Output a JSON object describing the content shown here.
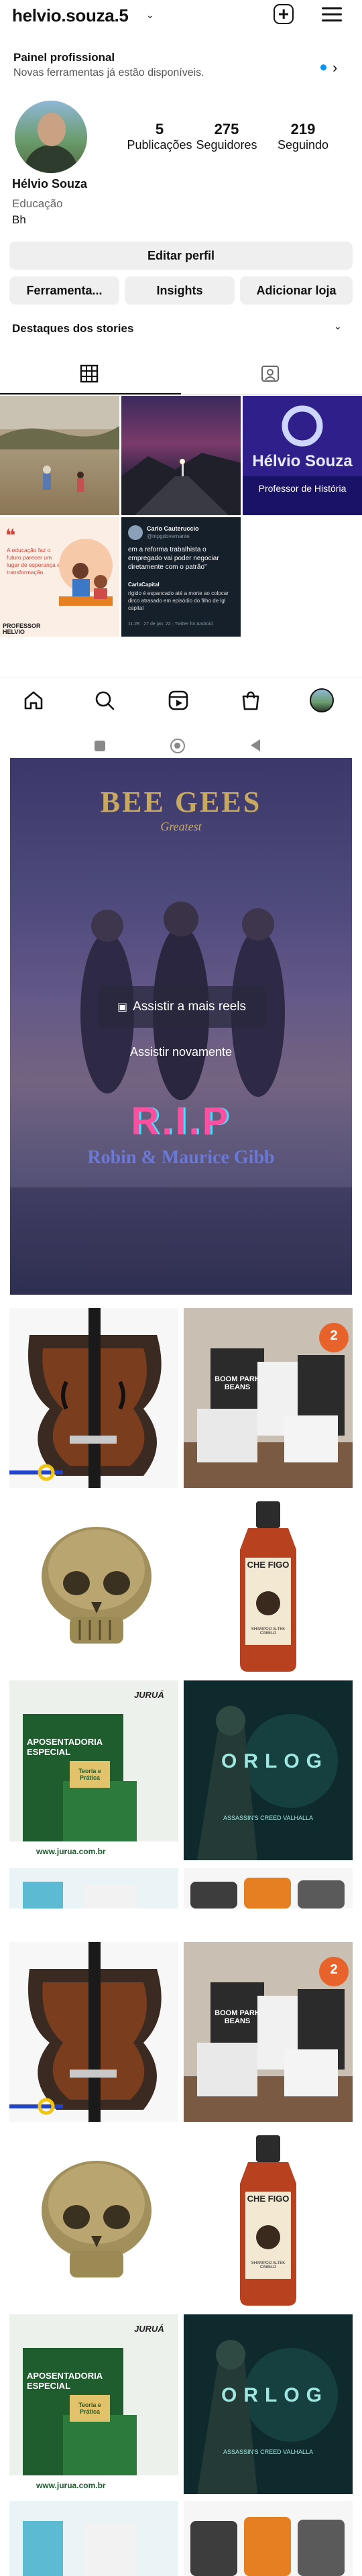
{
  "header": {
    "username": "helvio.souza.5",
    "chevron": "⌄"
  },
  "pro_dashboard": {
    "title": "Painel profissional",
    "subtitle": "Novas ferramentas já estão disponíveis.",
    "arrow": "›"
  },
  "profile": {
    "stats": [
      {
        "value": "5",
        "label": "Publicações"
      },
      {
        "value": "275",
        "label": "Seguidores"
      },
      {
        "value": "219",
        "label": "Seguindo"
      }
    ],
    "name": "Hélvio Souza",
    "category": "Educação",
    "bio": "Bh"
  },
  "buttons": {
    "edit_profile": "Editar perfil",
    "tools": "Ferramenta...",
    "insights": "Insights",
    "add_shop": "Adicionar loja"
  },
  "highlights": {
    "title": "Destaques dos stories"
  },
  "posts": {
    "brand_name": "Hélvio Souza",
    "brand_sub": "Professor de História",
    "quote": "A educação faz o futuro parecer um lugar de esperança e transformação.",
    "quote_sign": "PROFESSOR HELVIO",
    "tweet_name": "Carlo Cauteruccio",
    "tweet_handle": "@mpgdovernante",
    "tweet_text": "em a reforma trabalhista o empregado vai poder negociar diretamente com o patrão”",
    "tweet_reply_name": "CarlaCapital",
    "tweet_reply": "rígido é espancado até a morte ao colocar dirco atrasado em episódio do filho de lgl capital",
    "tweet_footer": "11:28 · 27 de jan. 22 · Twitter for Android"
  },
  "reel": {
    "watch_more": "Assistir a mais reels",
    "replay": "Assistir novamente",
    "band_title": "BEE GEES",
    "band_sub": "Greatest",
    "rip": "R.I.P",
    "names": "Robin & Maurice Gibb"
  },
  "feed": {
    "badge": "2",
    "bag_text": "BOOM PARK BEANS",
    "bottle_brand": "CHE FIGO",
    "bottle_sub": "SHAMPOO ALTEK CABELO",
    "book_title": "APOSENTADORIA ESPECIAL",
    "book_tag": "Teoria e Prática",
    "book_site": "www.jurua.com.br",
    "book_logo": "JURUÁ",
    "game_title": "ORLOG",
    "game_sub": "ASSASSIN'S CREED VALHALLA"
  }
}
